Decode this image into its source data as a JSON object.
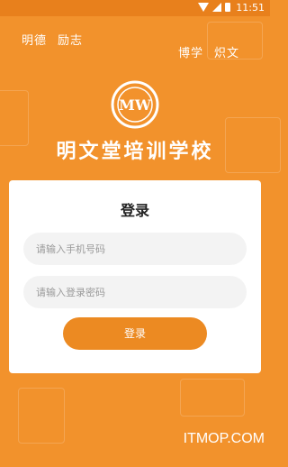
{
  "statusbar": {
    "time": "11:51",
    "icons": [
      "wifi-icon",
      "signal-icon",
      "battery-icon"
    ]
  },
  "motto": {
    "left": [
      "明德",
      "励志"
    ],
    "right": [
      "博学",
      "炽文"
    ]
  },
  "brand": {
    "logo_text": "MW",
    "school_name": "明文堂培训学校"
  },
  "login": {
    "title": "登录",
    "phone_placeholder": "请输入手机号码",
    "password_placeholder": "请输入登录密码",
    "submit_label": "登录"
  },
  "watermark": "ITMOP.COM",
  "colors": {
    "background": "#f2922c",
    "button": "#ec8a22",
    "card": "#ffffff"
  }
}
